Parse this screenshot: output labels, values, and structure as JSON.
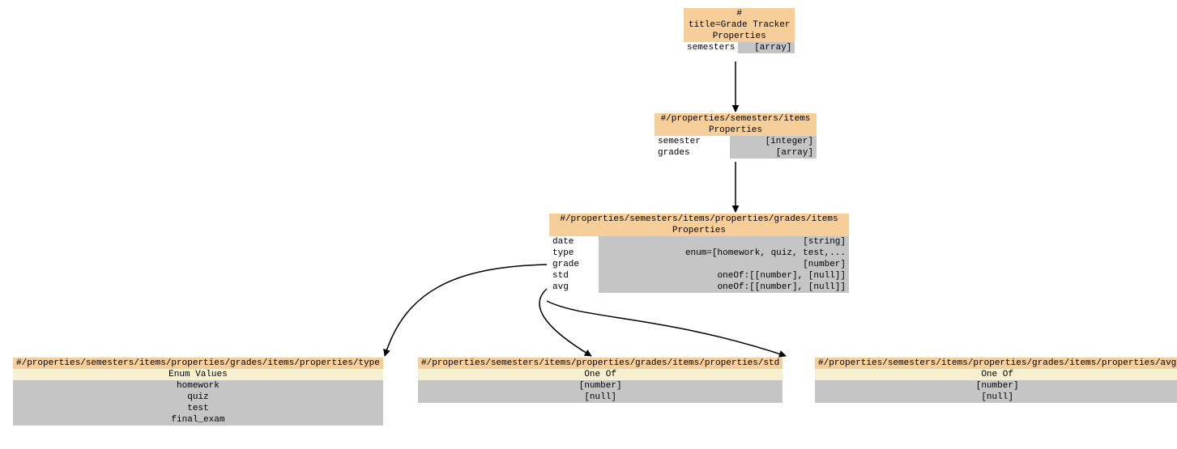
{
  "nodes": {
    "root": {
      "path": "#",
      "title": "title=Grade Tracker",
      "section": "Properties",
      "props": [
        {
          "k": "semesters",
          "v": "[array]"
        }
      ]
    },
    "semItems": {
      "path": "#/properties/semesters/items",
      "section": "Properties",
      "props": [
        {
          "k": "semester",
          "v": "[integer]"
        },
        {
          "k": "grades",
          "v": "[array]"
        }
      ]
    },
    "gradesItems": {
      "path": "#/properties/semesters/items/properties/grades/items",
      "section": "Properties",
      "props": [
        {
          "k": "date",
          "v": "[string]"
        },
        {
          "k": "type",
          "v": "enum=[homework, quiz, test,..."
        },
        {
          "k": "grade",
          "v": "[number]"
        },
        {
          "k": "std",
          "v": "oneOf:[[number], [null]]"
        },
        {
          "k": "avg",
          "v": "oneOf:[[number], [null]]"
        }
      ]
    },
    "typeEnum": {
      "path": "#/properties/semesters/items/properties/grades/items/properties/type",
      "section": "Enum Values",
      "values": [
        "homework",
        "quiz",
        "test",
        "final_exam"
      ]
    },
    "stdOneOf": {
      "path": "#/properties/semesters/items/properties/grades/items/properties/std",
      "section": "One Of",
      "values": [
        "[number]",
        "[null]"
      ]
    },
    "avgOneOf": {
      "path": "#/properties/semesters/items/properties/grades/items/properties/avg",
      "section": "One Of",
      "values": [
        "[number]",
        "[null]"
      ]
    }
  }
}
